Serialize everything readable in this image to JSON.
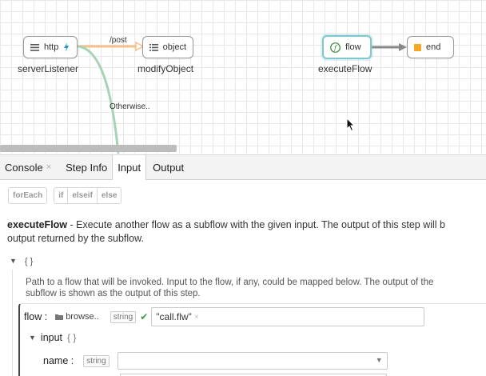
{
  "canvas": {
    "nodes": {
      "http": {
        "text": "http",
        "label": "serverListener"
      },
      "object": {
        "text": "object",
        "label": "modifyObject"
      },
      "flow": {
        "text": "flow",
        "label": "executeFlow"
      },
      "end": {
        "text": "end"
      }
    },
    "links": {
      "post": "/post",
      "otherwise": "Otherwise.."
    },
    "colors": {
      "post_link": "#f5c08a",
      "otherwise_link": "#a6d3b4",
      "flow_link": "#888888",
      "end_square": "#f5a623",
      "selected_border": "#7fc7d1"
    }
  },
  "tabs": [
    {
      "label": "Console",
      "closable": true
    },
    {
      "label": "Step Info"
    },
    {
      "label": "Input",
      "active": true
    },
    {
      "label": "Output"
    }
  ],
  "chips": {
    "foreach": "forEach",
    "if": "if",
    "elseif": "elseif",
    "else": "else"
  },
  "description": {
    "name": "executeFlow",
    "text": " - Execute another flow as a subflow with the given input. The output of this step will b",
    "text2": "output returned by the subflow."
  },
  "object_toggle": {
    "braces": "{ }"
  },
  "hint": "Path to a flow that will be invoked. Input to the flow, if any, could be mapped below. The output of the subflow is shown as the output of this step.",
  "flow_field": {
    "label": "flow :",
    "browse": "browse..",
    "type": "string",
    "value": "\"call.flw\""
  },
  "input_group": {
    "label": "input",
    "braces": "{ }"
  },
  "name_field": {
    "label": "name :",
    "type": "string",
    "value": ""
  }
}
